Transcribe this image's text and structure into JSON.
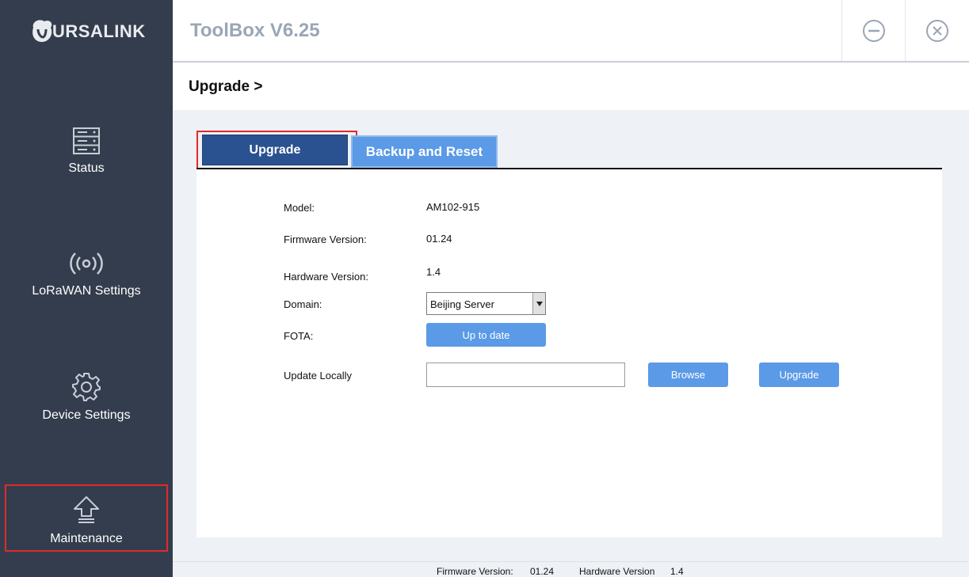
{
  "brand": {
    "logo_text": "URSALINK"
  },
  "sidebar": {
    "items": [
      {
        "label": "Status",
        "icon": "server-icon"
      },
      {
        "label": "LoRaWAN Settings",
        "icon": "radio-signal-icon"
      },
      {
        "label": "Device Settings",
        "icon": "gear-icon"
      },
      {
        "label": "Maintenance",
        "icon": "upload-arrow-icon"
      }
    ]
  },
  "header": {
    "title": "ToolBox V6.25"
  },
  "breadcrumb": {
    "text": "Upgrade >"
  },
  "tabs": [
    {
      "label": "Upgrade",
      "active": true
    },
    {
      "label": "Backup and Reset",
      "active": false
    }
  ],
  "form": {
    "model_label": "Model:",
    "model_value": "AM102-915",
    "firmware_label": "Firmware Version:",
    "firmware_value": "01.24",
    "hardware_label": "Hardware Version:",
    "hardware_value": "1.4",
    "domain_label": "Domain:",
    "domain_value": "Beijing Server",
    "fota_label": "FOTA:",
    "fota_button": "Up to date",
    "update_label": "Update Locally",
    "file_value": "",
    "browse_button": "Browse",
    "upgrade_button": "Upgrade"
  },
  "footer": {
    "firmware_label": "Firmware Version:",
    "firmware_value": "01.24",
    "hardware_label": "Hardware Version",
    "hardware_value": "1.4"
  },
  "colors": {
    "sidebar_bg": "#333d4d",
    "active_tab": "#2b5290",
    "button_blue": "#5b9ae6",
    "highlight_red": "#e02a2a"
  }
}
